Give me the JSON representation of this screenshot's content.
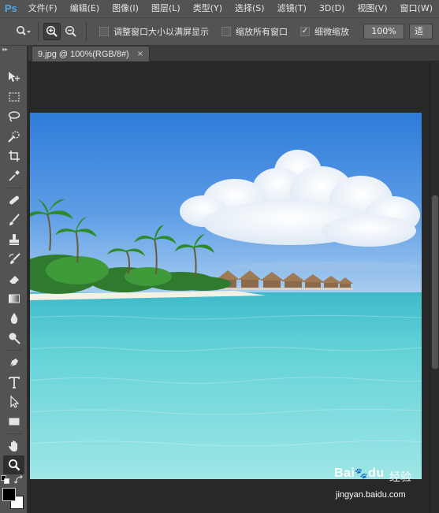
{
  "app": {
    "logo": "Ps"
  },
  "menu": [
    "文件(F)",
    "编辑(E)",
    "图像(I)",
    "图层(L)",
    "类型(Y)",
    "选择(S)",
    "滤镜(T)",
    "3D(D)",
    "视图(V)",
    "窗口(W)"
  ],
  "options": {
    "resize_windows_label": "调整窗口大小以满屏显示",
    "resize_windows_checked": false,
    "zoom_all_label": "缩放所有窗口",
    "zoom_all_checked": false,
    "scrubby_label": "细微缩放",
    "scrubby_checked": true,
    "check_mark": "✓",
    "percent_button": "100%",
    "fit_button": "适"
  },
  "document": {
    "tab_title": "9.jpg @ 100%(RGB/8#)",
    "close_glyph": "×"
  },
  "toolbar": {
    "grip": "▸▸"
  },
  "watermark": {
    "brand": "Bai",
    "brand_suffix": "du",
    "sub": "经验",
    "url": "jingyan.baidu.com"
  },
  "colors": {
    "panel": "#535353",
    "workspace": "#282828",
    "logo": "#4ea8e8",
    "foreground": "#000000",
    "background": "#ffffff"
  }
}
